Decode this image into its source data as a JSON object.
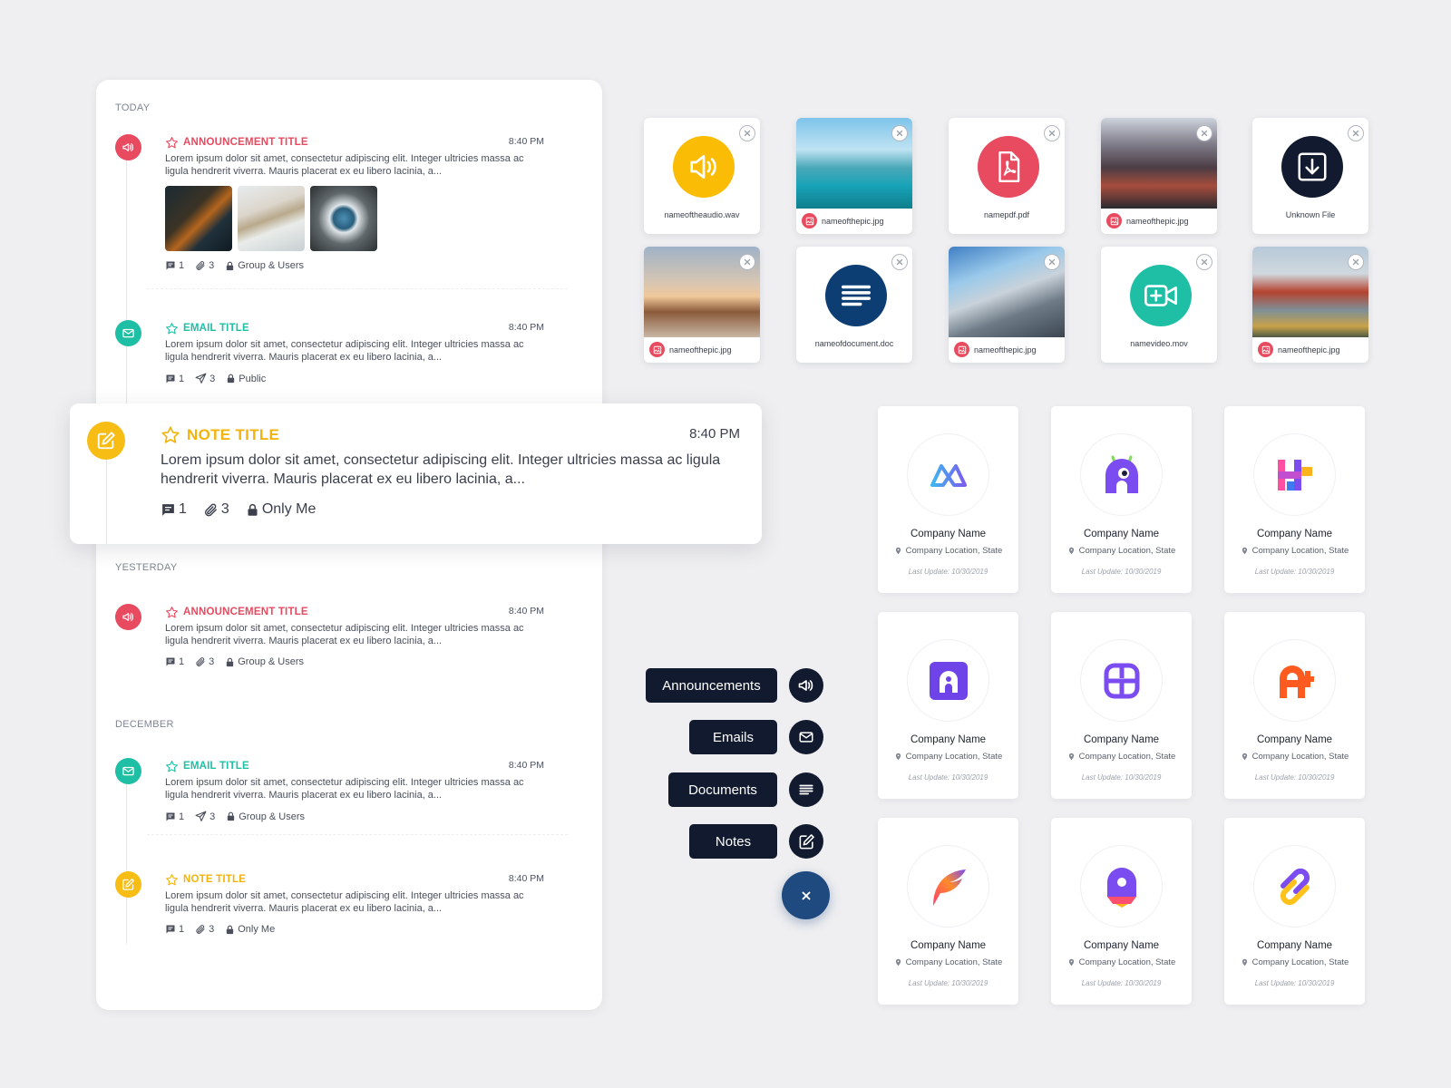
{
  "colors": {
    "announcement": "#e84a5f",
    "email": "#1fbfa6",
    "note": "#f7bd14",
    "fab_dark": "#111a2e",
    "fab_main": "#1f4a80"
  },
  "timeline": {
    "sections": {
      "today": "TODAY",
      "yesterday": "YESTERDAY",
      "december": "DECEMBER"
    },
    "lorem": "Lorem ipsum dolor sit amet, consectetur adipiscing elit. Integer ultricies massa ac ligula hendrerit viverra. Mauris placerat ex eu libero lacinia, a...",
    "entries": [
      {
        "title": "ANNOUNCEMENT TITLE",
        "time": "8:40 PM",
        "comments": "1",
        "attachments": "3",
        "visibility": "Group & Users",
        "icon": "megaphone-icon"
      },
      {
        "title": "EMAIL TITLE",
        "time": "8:40 PM",
        "comments": "1",
        "attachments": "3",
        "visibility": "Public",
        "icon": "envelope-icon"
      },
      {
        "title": "ANNOUNCEMENT TITLE",
        "time": "8:40 PM",
        "comments": "1",
        "attachments": "3",
        "visibility": "Group & Users",
        "icon": "megaphone-icon"
      },
      {
        "title": "EMAIL TITLE",
        "time": "8:40 PM",
        "comments": "1",
        "attachments": "3",
        "visibility": "Group & Users",
        "icon": "envelope-icon"
      },
      {
        "title": "NOTE TITLE",
        "time": "8:40 PM",
        "comments": "1",
        "attachments": "3",
        "visibility": "Only Me",
        "icon": "edit-icon"
      }
    ],
    "highlight": {
      "title": "NOTE TITLE",
      "time": "8:40 PM",
      "comments": "1",
      "attachments": "3",
      "visibility": "Only Me"
    }
  },
  "files": [
    {
      "name": "nameoftheaudio.wav",
      "type": "audio"
    },
    {
      "name": "nameofthepic.jpg",
      "type": "image"
    },
    {
      "name": "namepdf.pdf",
      "type": "pdf"
    },
    {
      "name": "nameofthepic.jpg",
      "type": "image"
    },
    {
      "name": "Unknown File",
      "type": "unknown"
    },
    {
      "name": "nameofthepic.jpg",
      "type": "image"
    },
    {
      "name": "nameofdocument.doc",
      "type": "document"
    },
    {
      "name": "nameofthepic.jpg",
      "type": "image"
    },
    {
      "name": "namevideo.mov",
      "type": "video"
    },
    {
      "name": "nameofthepic.jpg",
      "type": "image"
    }
  ],
  "fab_menu": {
    "announcements": "Announcements",
    "emails": "Emails",
    "documents": "Documents",
    "notes": "Notes",
    "close": "×"
  },
  "companies": [
    {
      "name": "Company Name",
      "location": "Company Location, State",
      "updated": "Last Update: 10/30/2019"
    },
    {
      "name": "Company Name",
      "location": "Company Location, State",
      "updated": "Last Update: 10/30/2019"
    },
    {
      "name": "Company Name",
      "location": "Company Location, State",
      "updated": "Last Update: 10/30/2019"
    },
    {
      "name": "Company Name",
      "location": "Company Location, State",
      "updated": "Last Update: 10/30/2019"
    },
    {
      "name": "Company Name",
      "location": "Company Location, State",
      "updated": "Last Update: 10/30/2019"
    },
    {
      "name": "Company Name",
      "location": "Company Location, State",
      "updated": "Last Update: 10/30/2019"
    },
    {
      "name": "Company Name",
      "location": "Company Location, State",
      "updated": "Last Update: 10/30/2019"
    },
    {
      "name": "Company Name",
      "location": "Company Location, State",
      "updated": "Last Update: 10/30/2019"
    },
    {
      "name": "Company Name",
      "location": "Company Location, State",
      "updated": "Last Update: 10/30/2019"
    }
  ]
}
